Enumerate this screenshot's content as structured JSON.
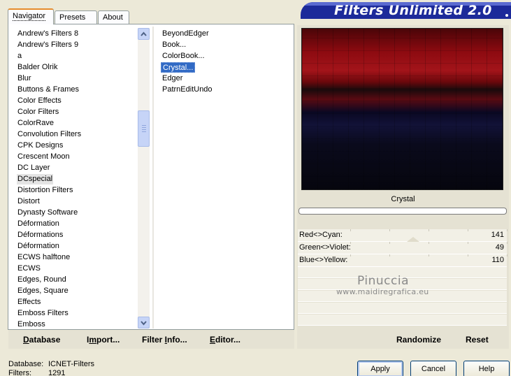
{
  "tabs": [
    {
      "label": "Navigator"
    },
    {
      "label": "Presets"
    },
    {
      "label": "About"
    }
  ],
  "banner": {
    "title": "Filters Unlimited 2.0"
  },
  "categories": {
    "selected": "DCspecial",
    "items": [
      "Andrew's Filters 8",
      "Andrew's Filters 9",
      "a",
      "Balder Olrik",
      "Blur",
      "Buttons & Frames",
      "Color Effects",
      "Color Filters",
      "ColorRave",
      "Convolution Filters",
      "CPK Designs",
      "Crescent Moon",
      "DC Layer",
      "DCspecial",
      "Distortion Filters",
      "Distort",
      "Dynasty Software",
      "Déformation",
      "Déformations",
      "Déformation",
      "ECWS halftone",
      "ECWS",
      "Edges, Round",
      "Edges, Square",
      "Effects",
      "Emboss Filters",
      "Emboss"
    ]
  },
  "filters": {
    "selected": "Crystal...",
    "items": [
      "BeyondEdger",
      "Book...",
      "ColorBook...",
      "Crystal...",
      "Edger",
      "PatrnEditUndo"
    ]
  },
  "left_bar": {
    "database": {
      "u": "D",
      "rest": "atabase"
    },
    "import": {
      "pre": "I",
      "u": "m",
      "rest": "port..."
    },
    "filter_info": {
      "pre": "Filter ",
      "u": "I",
      "rest": "nfo..."
    },
    "editor": {
      "u": "E",
      "rest": "ditor..."
    }
  },
  "preview": {
    "filter_name": "Crystal"
  },
  "sliders": [
    {
      "label": "Red<>Cyan:",
      "value": "141",
      "fraction": 0.553
    },
    {
      "label": "Green<>Violet:",
      "value": "49",
      "fraction": 0.192
    },
    {
      "label": "Blue<>Yellow:",
      "value": "110",
      "fraction": 0.431
    }
  ],
  "right_bar": {
    "randomize": "Randomize",
    "reset": "Reset"
  },
  "watermark": {
    "name": "Pinuccia",
    "url": "www.maidiregrafica.eu"
  },
  "status": {
    "database_label": "Database:",
    "database_value": "ICNET-Filters",
    "filters_label": "Filters:",
    "filters_value": "1291"
  },
  "buttons": {
    "apply": "Apply",
    "cancel": "Cancel",
    "help": "Help"
  },
  "colors": {
    "banner": "#1c2a9a",
    "selection": "#316ac5",
    "tab_highlight": "#e68b2c"
  }
}
